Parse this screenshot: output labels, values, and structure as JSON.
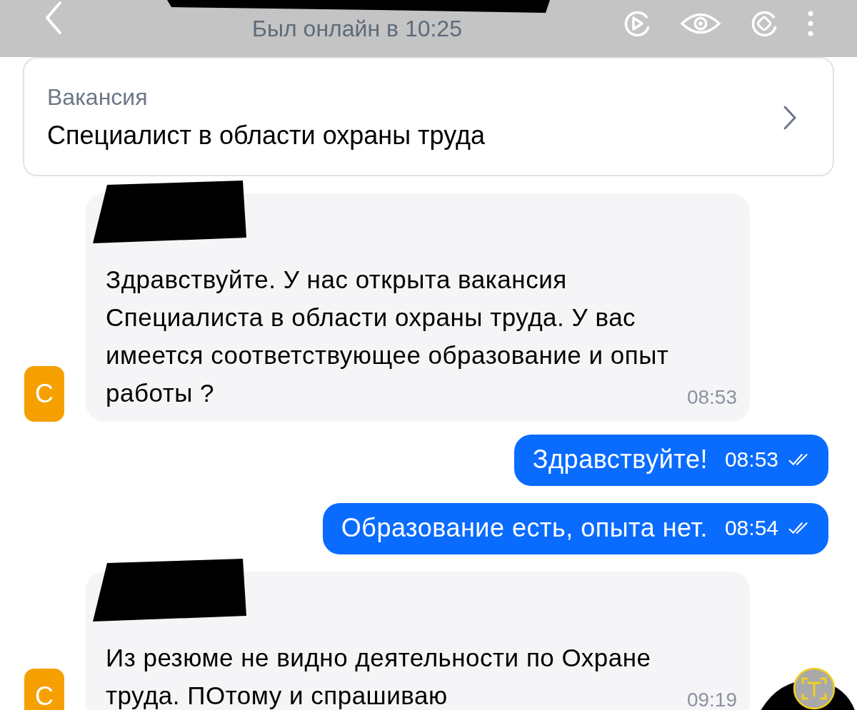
{
  "header": {
    "subtitle": "Был онлайн в 10:25"
  },
  "vacancy": {
    "label": "Вакансия",
    "title": "Специалист в области охраны труда"
  },
  "messages": [
    {
      "kind": "in",
      "avatar": "С",
      "text": "Здравствуйте. У нас открыта вакансия Специалиста в области охраны труда. У вас имеется соответствующее образование и опыт работы ?",
      "time": "08:53"
    },
    {
      "kind": "out",
      "text": "Здравствуйте!",
      "time": "08:53",
      "read": true
    },
    {
      "kind": "out",
      "text": "Образование есть, опыта нет.",
      "time": "08:54",
      "read": true
    },
    {
      "kind": "in",
      "avatar": "С",
      "text": "Из резюме не видно деятельности по Охране труда. ПОтому и спрашиваю",
      "time": "09:19"
    }
  ]
}
